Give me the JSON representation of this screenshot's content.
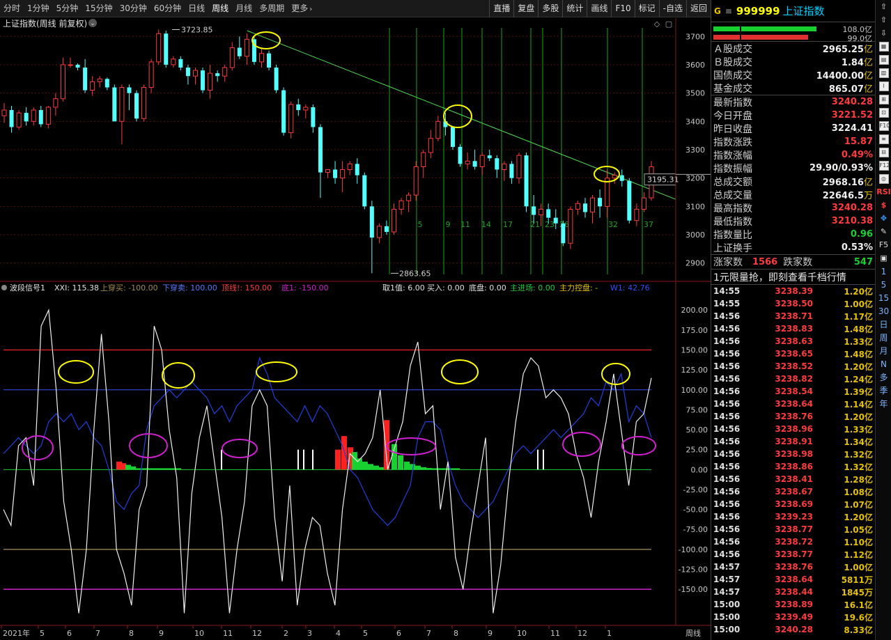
{
  "toolbar": {
    "periods": [
      "分时",
      "1分钟",
      "5分钟",
      "15分钟",
      "30分钟",
      "60分钟",
      "日线",
      "周线",
      "月线",
      "多周期",
      "更多"
    ],
    "active_period": "周线",
    "buttons": [
      "直播",
      "复盘",
      "多股",
      "统计",
      "画线",
      "F10",
      "标记",
      "-自选",
      "返回"
    ]
  },
  "chart": {
    "title": "上证指数(周线 前复权)",
    "high_label": "3723.85",
    "low_label": "2863.65",
    "last_price_tag": "3195.31",
    "y_axis": [
      "3700",
      "3600",
      "3500",
      "3400",
      "3300",
      "3200",
      "3100",
      "3000",
      "2900"
    ],
    "cycle_numbers": [
      "5",
      "9",
      "11",
      "14",
      "17",
      "21",
      "23",
      "26",
      "32",
      "37"
    ],
    "x_axis": [
      "2021年",
      "5",
      "6",
      "7",
      "8",
      "9",
      "10",
      "11",
      "12",
      "2",
      "3",
      "4",
      "5",
      "6",
      "7",
      "8",
      "9",
      "10",
      "11",
      "12",
      "1"
    ],
    "period_label": "周线"
  },
  "chart_data": {
    "type": "candlestick",
    "title": "上证指数(周线 前复权)",
    "ylim": [
      2860,
      3740
    ],
    "candles": [
      [
        3420,
        3465,
        3395,
        3440
      ],
      [
        3440,
        3455,
        3360,
        3380
      ],
      [
        3380,
        3440,
        3370,
        3430
      ],
      [
        3430,
        3450,
        3385,
        3400
      ],
      [
        3400,
        3450,
        3385,
        3440
      ],
      [
        3440,
        3455,
        3380,
        3390
      ],
      [
        3390,
        3455,
        3375,
        3450
      ],
      [
        3450,
        3500,
        3420,
        3480
      ],
      [
        3480,
        3625,
        3470,
        3600
      ],
      [
        3600,
        3625,
        3590,
        3600
      ],
      [
        3600,
        3605,
        3580,
        3590
      ],
      [
        3590,
        3620,
        3500,
        3510
      ],
      [
        3510,
        3560,
        3490,
        3540
      ],
      [
        3540,
        3560,
        3520,
        3550
      ],
      [
        3550,
        3555,
        3510,
        3520
      ],
      [
        3520,
        3530,
        3400,
        3400
      ],
      [
        3400,
        3530,
        3320,
        3520
      ],
      [
        3520,
        3530,
        3440,
        3500
      ],
      [
        3500,
        3510,
        3400,
        3410
      ],
      [
        3410,
        3530,
        3400,
        3520
      ],
      [
        3520,
        3620,
        3500,
        3610
      ],
      [
        3610,
        3724,
        3600,
        3710
      ],
      [
        3710,
        3720,
        3590,
        3600
      ],
      [
        3600,
        3630,
        3590,
        3620
      ],
      [
        3620,
        3630,
        3580,
        3590
      ],
      [
        3590,
        3600,
        3530,
        3560
      ],
      [
        3560,
        3590,
        3530,
        3580
      ],
      [
        3580,
        3590,
        3500,
        3510
      ],
      [
        3510,
        3600,
        3480,
        3570
      ],
      [
        3570,
        3580,
        3540,
        3560
      ],
      [
        3560,
        3600,
        3540,
        3590
      ],
      [
        3590,
        3680,
        3580,
        3660
      ],
      [
        3660,
        3700,
        3620,
        3630
      ],
      [
        3630,
        3710,
        3600,
        3690
      ],
      [
        3690,
        3700,
        3600,
        3610
      ],
      [
        3610,
        3660,
        3590,
        3640
      ],
      [
        3640,
        3650,
        3580,
        3590
      ],
      [
        3590,
        3600,
        3500,
        3510
      ],
      [
        3510,
        3520,
        3350,
        3360
      ],
      [
        3360,
        3470,
        3340,
        3460
      ],
      [
        3460,
        3480,
        3420,
        3440
      ],
      [
        3440,
        3460,
        3410,
        3450
      ],
      [
        3450,
        3460,
        3360,
        3380
      ],
      [
        3380,
        3390,
        3130,
        3220
      ],
      [
        3220,
        3230,
        3200,
        3230
      ],
      [
        3230,
        3260,
        3180,
        3200
      ],
      [
        3200,
        3260,
        3150,
        3230
      ],
      [
        3230,
        3260,
        3210,
        3250
      ],
      [
        3250,
        3270,
        3180,
        3210
      ],
      [
        3210,
        3220,
        3090,
        3100
      ],
      [
        3100,
        3120,
        2864,
        2990
      ],
      [
        2990,
        3040,
        2970,
        3030
      ],
      [
        3030,
        3050,
        3000,
        3010
      ],
      [
        3010,
        3110,
        3000,
        3090
      ],
      [
        3090,
        3130,
        3070,
        3120
      ],
      [
        3120,
        3150,
        3080,
        3140
      ],
      [
        3140,
        3260,
        3120,
        3240
      ],
      [
        3240,
        3300,
        3200,
        3290
      ],
      [
        3290,
        3370,
        3270,
        3340
      ],
      [
        3340,
        3420,
        3330,
        3400
      ],
      [
        3400,
        3430,
        3350,
        3380
      ],
      [
        3380,
        3380,
        3300,
        3310
      ],
      [
        3310,
        3320,
        3240,
        3250
      ],
      [
        3250,
        3290,
        3230,
        3260
      ],
      [
        3260,
        3300,
        3230,
        3240
      ],
      [
        3240,
        3290,
        3210,
        3280
      ],
      [
        3280,
        3300,
        3260,
        3270
      ],
      [
        3270,
        3280,
        3200,
        3230
      ],
      [
        3230,
        3260,
        3190,
        3250
      ],
      [
        3250,
        3260,
        3180,
        3200
      ],
      [
        3200,
        3290,
        3180,
        3280
      ],
      [
        3280,
        3290,
        3080,
        3100
      ],
      [
        3100,
        3140,
        3040,
        3070
      ],
      [
        3070,
        3110,
        3030,
        3090
      ],
      [
        3090,
        3110,
        3040,
        3060
      ],
      [
        3060,
        3090,
        3020,
        3040
      ],
      [
        3040,
        3050,
        2960,
        2970
      ],
      [
        2970,
        3100,
        2950,
        3090
      ],
      [
        3090,
        3120,
        3070,
        3110
      ],
      [
        3110,
        3130,
        3060,
        3080
      ],
      [
        3080,
        3140,
        3040,
        3130
      ],
      [
        3130,
        3160,
        3060,
        3100
      ],
      [
        3100,
        3230,
        3060,
        3200
      ],
      [
        3200,
        3220,
        3180,
        3210
      ],
      [
        3210,
        3230,
        3170,
        3190
      ],
      [
        3190,
        3200,
        3040,
        3050
      ],
      [
        3050,
        3110,
        3030,
        3090
      ],
      [
        3090,
        3150,
        3080,
        3130
      ],
      [
        3130,
        3260,
        3120,
        3240
      ]
    ],
    "trendline": [
      [
        3710,
        0
      ],
      [
        3100,
        1
      ]
    ],
    "indicator": {
      "name": "波段信号1",
      "xxi": 115.38,
      "upper_cross_buy": -100.0,
      "lower_cross_sell": 100.0,
      "top_line": 150.0,
      "bottom_line": -150.0,
      "fetch_value": 6.0,
      "buy_in": 0.0,
      "bottom": 0.0,
      "main_inflow": 0.0,
      "main_control": "-",
      "w1": 42.76,
      "ylim": [
        -190,
        215
      ],
      "y_ticks": [
        200,
        175,
        150,
        125,
        100,
        75,
        50,
        25,
        0,
        -25,
        -50,
        -75,
        -100,
        -125,
        -150
      ],
      "white": [
        -50,
        -70,
        30,
        40,
        -20,
        180,
        200,
        100,
        -40,
        -100,
        -180,
        -100,
        50,
        170,
        60,
        -100,
        -130,
        -170,
        -50,
        -20,
        180,
        150,
        50,
        -10,
        -180,
        -30,
        40,
        80,
        10,
        -60,
        -180,
        -100,
        -40,
        80,
        100,
        80,
        -60,
        -140,
        -20,
        -170,
        -100,
        -60,
        -70,
        -130,
        -170,
        -50,
        20,
        10,
        20,
        40,
        100,
        0,
        30,
        60,
        130,
        160,
        70,
        80,
        -50,
        10,
        -110,
        -150,
        -80,
        -20,
        40,
        -180,
        -120,
        -20,
        60,
        120,
        140,
        130,
        90,
        100,
        90,
        70,
        20,
        -10,
        -60,
        10,
        60,
        120,
        50,
        -20,
        60,
        70,
        115
      ],
      "blue": [
        20,
        30,
        40,
        30,
        20,
        30,
        60,
        70,
        60,
        70,
        50,
        60,
        40,
        30,
        0,
        -40,
        -50,
        -30,
        -20,
        50,
        80,
        90,
        100,
        90,
        100,
        110,
        100,
        90,
        70,
        80,
        60,
        80,
        90,
        100,
        140,
        120,
        90,
        80,
        70,
        60,
        80,
        60,
        80,
        70,
        50,
        30,
        0,
        -10,
        -30,
        -50,
        -60,
        -70,
        -60,
        -40,
        -20,
        40,
        60,
        60,
        50,
        10,
        -20,
        -40,
        -50,
        -60,
        -50,
        -40,
        -20,
        0,
        20,
        30,
        20,
        30,
        40,
        50,
        40,
        50,
        60,
        70,
        90,
        80,
        110,
        100,
        120,
        60,
        80,
        70,
        40
      ]
    }
  },
  "right_panel": {
    "header": {
      "badge": "G",
      "menu": "≡",
      "code": "999999",
      "name": "上证指数"
    },
    "vol_labels": [
      "108.0亿",
      "99.0亿"
    ],
    "stats1": [
      {
        "label": "Ａ股成交",
        "value": "2965.25",
        "unit": "亿",
        "color": "white"
      },
      {
        "label": "Ｂ股成交",
        "value": "1.84",
        "unit": "亿",
        "color": "white"
      },
      {
        "label": "国债成交",
        "value": "14400.00",
        "unit": "亿",
        "color": "white"
      },
      {
        "label": "基金成交",
        "value": "865.07",
        "unit": "亿",
        "color": "white"
      }
    ],
    "stats2": [
      {
        "label": "最新指数",
        "value": "3240.28",
        "unit": "",
        "color": "red"
      },
      {
        "label": "今日开盘",
        "value": "3221.52",
        "unit": "",
        "color": "red"
      },
      {
        "label": "昨日收盘",
        "value": "3224.41",
        "unit": "",
        "color": "white"
      },
      {
        "label": "指数涨跌",
        "value": "15.87",
        "unit": "",
        "color": "red"
      },
      {
        "label": "指数涨幅",
        "value": "0.49%",
        "unit": "",
        "color": "red"
      },
      {
        "label": "指数振幅",
        "value": "29.90/0.93%",
        "unit": "",
        "color": "white"
      },
      {
        "label": "总成交额",
        "value": "2968.16",
        "unit": "亿",
        "color": "white"
      },
      {
        "label": "总成交量",
        "value": "22646.5",
        "unit": "万",
        "color": "white"
      },
      {
        "label": "最高指数",
        "value": "3240.28",
        "unit": "",
        "color": "red"
      },
      {
        "label": "最低指数",
        "value": "3210.38",
        "unit": "",
        "color": "red"
      },
      {
        "label": "指数量比",
        "value": "0.96",
        "unit": "",
        "color": "green"
      },
      {
        "label": "上证换手",
        "value": "0.53%",
        "unit": "",
        "color": "white"
      }
    ],
    "updown": {
      "up_label": "涨家数",
      "up": "1566",
      "down_label": "跌家数",
      "down": "547"
    },
    "promo": "1元限量抢，即刻查看千档行情",
    "ticks": [
      [
        "14:55",
        "3238.39",
        "1.20亿"
      ],
      [
        "14:55",
        "3238.50",
        "1.00亿"
      ],
      [
        "14:56",
        "3238.71",
        "1.17亿"
      ],
      [
        "14:56",
        "3238.83",
        "1.48亿"
      ],
      [
        "14:56",
        "3238.63",
        "1.33亿"
      ],
      [
        "14:56",
        "3238.65",
        "1.48亿"
      ],
      [
        "14:56",
        "3238.52",
        "1.20亿"
      ],
      [
        "14:56",
        "3238.82",
        "1.24亿"
      ],
      [
        "14:56",
        "3238.54",
        "1.39亿"
      ],
      [
        "14:56",
        "3238.64",
        "1.14亿"
      ],
      [
        "14:56",
        "3238.76",
        "1.20亿"
      ],
      [
        "14:56",
        "3238.96",
        "1.33亿"
      ],
      [
        "14:56",
        "3238.91",
        "1.34亿"
      ],
      [
        "14:56",
        "3238.98",
        "1.32亿"
      ],
      [
        "14:56",
        "3238.86",
        "1.32亿"
      ],
      [
        "14:56",
        "3238.41",
        "1.28亿"
      ],
      [
        "14:56",
        "3238.67",
        "1.08亿"
      ],
      [
        "14:56",
        "3238.69",
        "1.07亿"
      ],
      [
        "14:56",
        "3239.23",
        "1.20亿"
      ],
      [
        "14:56",
        "3238.77",
        "1.05亿"
      ],
      [
        "14:56",
        "3238.72",
        "1.10亿"
      ],
      [
        "14:56",
        "3238.77",
        "1.12亿"
      ],
      [
        "14:57",
        "3238.76",
        "1.00亿"
      ],
      [
        "14:57",
        "3238.64",
        "5811万"
      ],
      [
        "14:57",
        "3238.44",
        "1845万"
      ],
      [
        "15:00",
        "3238.89",
        "16.1亿"
      ],
      [
        "15:00",
        "3239.49",
        "19.6亿"
      ],
      [
        "15:00",
        "3240.28",
        "8.33亿"
      ]
    ]
  },
  "icons": {
    "side": [
      "⇧",
      "⇧",
      "⇩",
      "▦",
      "▤",
      "▥",
      "⌇",
      "⊞",
      "⊡",
      "F10",
      "≡",
      "⊟",
      "F12",
      "◎",
      "RSI",
      "$",
      "✥",
      "✎",
      "F5",
      "▣",
      "1",
      "5",
      "15",
      "30",
      "日",
      "周",
      "月",
      "N",
      "多",
      "季",
      "年"
    ]
  },
  "colors": {
    "up": "#ff3b3b",
    "down": "#54ffff",
    "cycle": "#1aa51a",
    "trend": "#4ee04e",
    "highlight_yellow": "#ffff00",
    "highlight_magenta": "#d020d0"
  }
}
